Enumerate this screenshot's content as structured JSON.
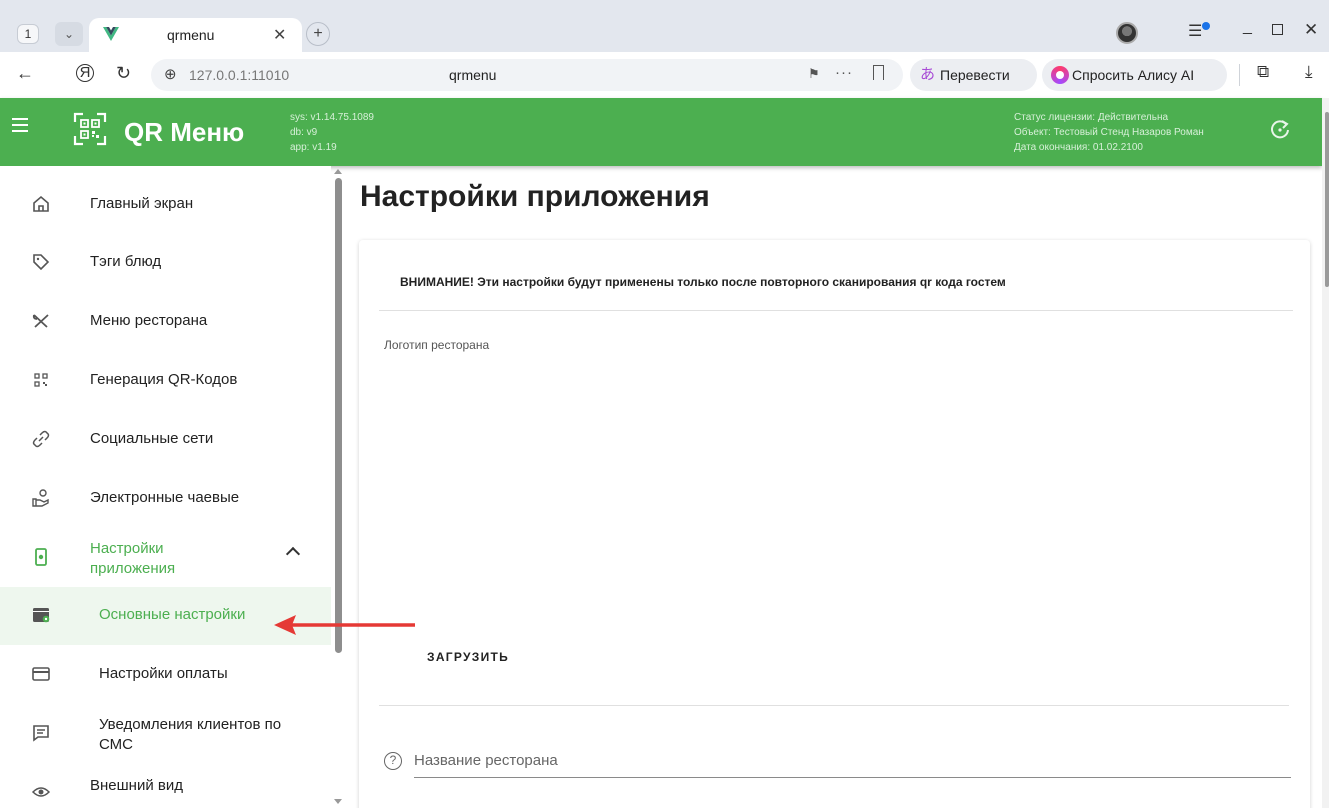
{
  "browser": {
    "tab_count": "1",
    "tab_title": "qrmenu",
    "url": "127.0.0.1:11010",
    "page_title": "qrmenu",
    "translate_label": "Перевести",
    "alisa_label": "Спросить Алису AI"
  },
  "app": {
    "brand": "QR Меню",
    "version_sys": "sys: v1.14.75.1089",
    "version_db": "db: v9",
    "version_app": "app: v1.19",
    "license_status": "Статус лицензии: Действительна",
    "license_object": "Объект: Тестовый Стенд Назаров Роман",
    "license_expiry": "Дата окончания: 01.02.2100",
    "accent_color": "#4caf50"
  },
  "sidebar": {
    "items": [
      {
        "label": "Главный экран",
        "icon": "home-icon"
      },
      {
        "label": "Тэги блюд",
        "icon": "tag-icon"
      },
      {
        "label": "Меню ресторана",
        "icon": "cutlery-icon"
      },
      {
        "label": "Генерация QR-Кодов",
        "icon": "qr-code-icon"
      },
      {
        "label": "Социальные сети",
        "icon": "link-icon"
      },
      {
        "label": "Электронные чаевые",
        "icon": "tips-hand-icon"
      },
      {
        "label": "Настройки приложения",
        "icon": "app-settings-icon"
      },
      {
        "label": "Основные настройки",
        "icon": "settings-window-icon"
      },
      {
        "label": "Настройки оплаты",
        "icon": "credit-card-icon"
      },
      {
        "label": "Уведомления клиентов по СМС",
        "icon": "message-icon"
      },
      {
        "label": "Внешний вид",
        "icon": "eye-icon"
      }
    ]
  },
  "main": {
    "title": "Настройки приложения",
    "warning": "ВНИМАНИЕ! Эти настройки будут применены только после повторного сканирования qr кода гостем",
    "logo_label": "Логотип ресторана",
    "upload_label": "ЗАГРУЗИТЬ",
    "name_placeholder": "Название ресторана"
  }
}
